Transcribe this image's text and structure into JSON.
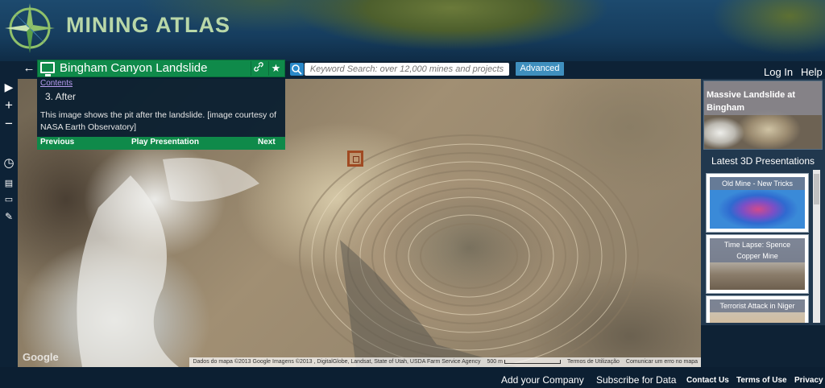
{
  "app": {
    "logo_text": "MINING ATLAS"
  },
  "toolbar": {
    "presentation_title": "Bingham Canyon Landslide",
    "search_placeholder": "Keyword Search: over 12,000 mines and projects",
    "advanced_label": "Advanced",
    "login_label": "Log In",
    "help_label": "Help",
    "back_icon": "←",
    "share_icon": "link-icon",
    "favorite_icon": "★"
  },
  "info_panel": {
    "contents_link": "Contents",
    "step_title": "3. After",
    "step_body": "This image shows the pit after the landslide. [image courtesy of NASA Earth Observatory]",
    "previous_label": "Previous",
    "play_label": "Play Presentation",
    "next_label": "Next"
  },
  "left_rail": {
    "icons": [
      "play-icon",
      "zoom-in-icon",
      "zoom-out-icon",
      "clock-icon",
      "document-icon",
      "folder-icon",
      "pencil-icon"
    ],
    "glyphs": {
      "play": "▶",
      "zoom_in": "+",
      "zoom_out": "−",
      "clock": "◷",
      "document": "▤",
      "folder": "▭",
      "pencil": "✎"
    }
  },
  "map": {
    "google_watermark": "Google",
    "attribution": "Dados do mapa ©2013 Google Imagens ©2013 , DigitalGlobe, Landsat, State of Utah, USDA Farm Service Agency",
    "scale_label": "500 m",
    "terms_label": "Termos de Utilização",
    "report_label": "Comunicar um erro no mapa"
  },
  "right_panel": {
    "featured_title": "Massive Landslide at Bingham",
    "latest_header": "Latest 3D Presentations",
    "latest_items": [
      {
        "title": "Old Mine - New Tricks"
      },
      {
        "title": "Time Lapse: Spence Copper Mine"
      },
      {
        "title": "Terrorist Attack in Niger"
      }
    ]
  },
  "footer": {
    "add_company": "Add your Company",
    "subscribe": "Subscribe for Data",
    "contact": "Contact Us",
    "terms": "Terms of Use",
    "privacy": "Privacy"
  },
  "colors": {
    "accent_green": "#0f8a4a",
    "nav_dark": "#0d2236",
    "advanced_blue": "#3f8fbe",
    "link_purple": "#b79cf0"
  }
}
